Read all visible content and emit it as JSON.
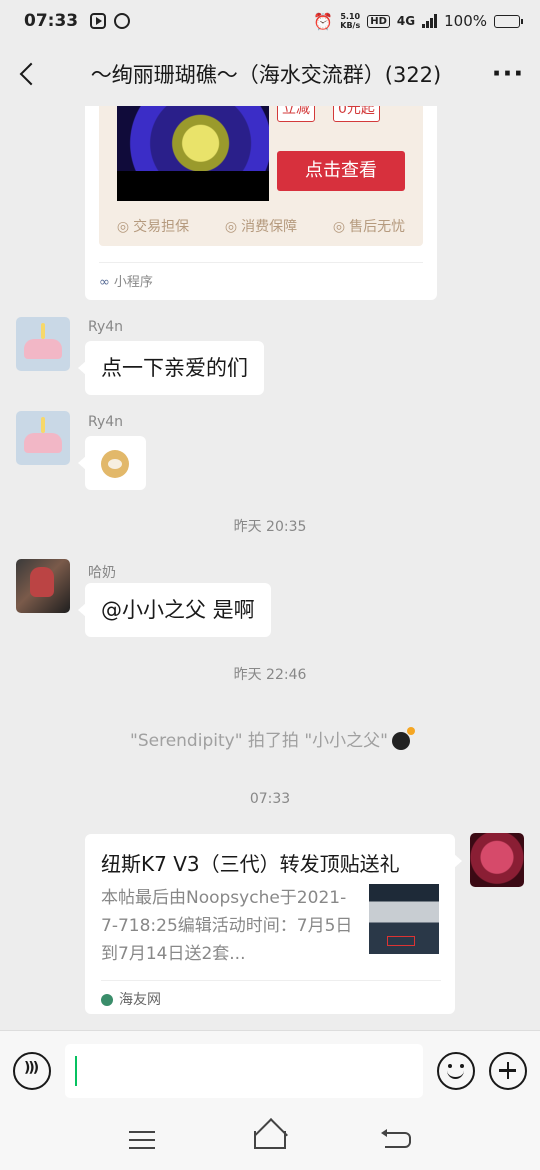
{
  "status_bar": {
    "time": "07:33",
    "net_speed_value": "5.10",
    "net_speed_unit": "KB/s",
    "hd": "HD",
    "network": "4G",
    "battery": "100%"
  },
  "header": {
    "title": "〜绚丽珊瑚礁〜（海水交流群）(322)",
    "more": "···"
  },
  "messages": {
    "mini_program": {
      "tag_discount": "立减",
      "tag_price": "0元起",
      "view_button": "点击查看",
      "guarantees": [
        "交易担保",
        "消费保障",
        "售后无忧"
      ],
      "footer": "小程序"
    },
    "msg1": {
      "sender": "Ry4n",
      "text": "点一下亲爱的们"
    },
    "msg2": {
      "sender": "Ry4n",
      "sticker": "doge-emoji"
    },
    "time1": "昨天 20:35",
    "msg3": {
      "sender": "哈奶",
      "text": "@小小之父  是啊"
    },
    "time2": "昨天 22:46",
    "system": "\"Serendipity\" 拍了拍 \"小小之父\"",
    "time3": "07:33",
    "link_card": {
      "title": "纽斯K7 V3（三代）转发顶贴送礼",
      "description": "本帖最后由Noopsyche于2021-7-718:25编辑活动时间：7月5日到7月14日送2套...",
      "source": "海友网"
    }
  },
  "icons": {
    "voice": "voice-icon",
    "emoji": "emoji-icon",
    "plus": "plus-icon",
    "bomb": "bomb-icon"
  },
  "colors": {
    "accent_green": "#07c160",
    "chat_bg": "#ededed",
    "promo_red": "#d7303d"
  }
}
